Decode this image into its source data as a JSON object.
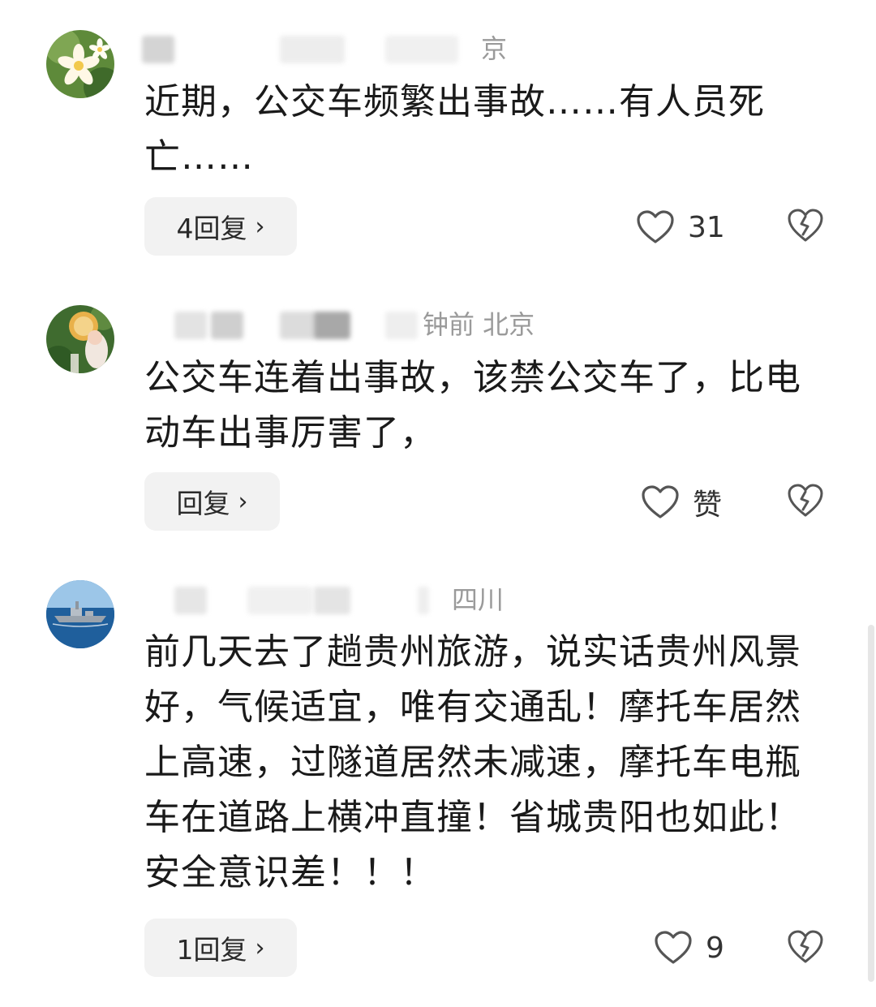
{
  "comments": [
    {
      "meta": {
        "visible_text": "京"
      },
      "text": "近期，公交车频繁出事故……有人员死亡……",
      "reply_label": "4回复",
      "like_text": "31"
    },
    {
      "meta": {
        "visible_text": "钟前   北京"
      },
      "text": "公交车连着出事故，该禁公交车了，比电动车出事厉害了，",
      "reply_label": "回复",
      "like_text": "赞"
    },
    {
      "meta": {
        "visible_text": "四川"
      },
      "text": "前几天去了趟贵州旅游，说实话贵州风景好，气候适宜，唯有交通乱！摩托车居然上高速，过隧道居然未减速，摩托车电瓶车在道路上横冲直撞！省城贵阳也如此！安全意识差！！！",
      "reply_label": "1回复",
      "like_text": "9"
    }
  ],
  "icons": {
    "like": "heart-outline-icon",
    "dislike": "broken-heart-icon",
    "reply_arrow": "chevron-right-icon"
  },
  "colors": {
    "text": "#1a1a1a",
    "meta": "#9a9a9a",
    "reply_bg": "#f2f2f2",
    "icon": "#555555"
  }
}
